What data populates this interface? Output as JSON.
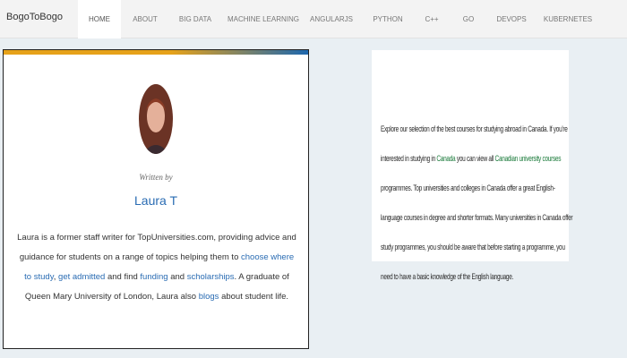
{
  "navbar": {
    "brand": "BogoToBogo",
    "items": [
      {
        "label": "HOME",
        "active": true
      },
      {
        "label": "ABOUT"
      },
      {
        "label": "BIG DATA"
      },
      {
        "label": "MACHINE LEARNING"
      },
      {
        "label": "ANGULARJS"
      },
      {
        "label": "PYTHON"
      },
      {
        "label": "C++"
      },
      {
        "label": "GO"
      },
      {
        "label": "DEVOPS"
      },
      {
        "label": "KUBERNETES"
      }
    ]
  },
  "author_card": {
    "accent_colors": [
      "#e6a21a",
      "#1d67ae"
    ],
    "written_by": "Written by",
    "author_name": "Laura T",
    "bio": {
      "t1": "Laura is a former staff writer for TopUniversities.com, providing advice and guidance for students on a range of topics helping them to ",
      "l1": "choose where to study",
      "t2": ", ",
      "l2": "get admitted",
      "t3": " and find ",
      "l3": "funding",
      "t4": " and ",
      "l4": "scholarships",
      "t5": ". A graduate of Queen Mary University of London, Laura also ",
      "l5": "blogs",
      "t6": " about student life."
    }
  },
  "right_content": {
    "t1": "Explore our selection of the best courses for studying abroad in Canada. If you're interested in studying in ",
    "l1": "Canada",
    "t2": " you can view all ",
    "l2": "Canadian university courses",
    "t3": " programmes. Top universities and colleges in Canada offer a great English-language courses in degree and shorter formats. Many universities in Canada offer study programmes, you should be aware that before starting a programme, you need to have a basic knowledge of the English language."
  }
}
